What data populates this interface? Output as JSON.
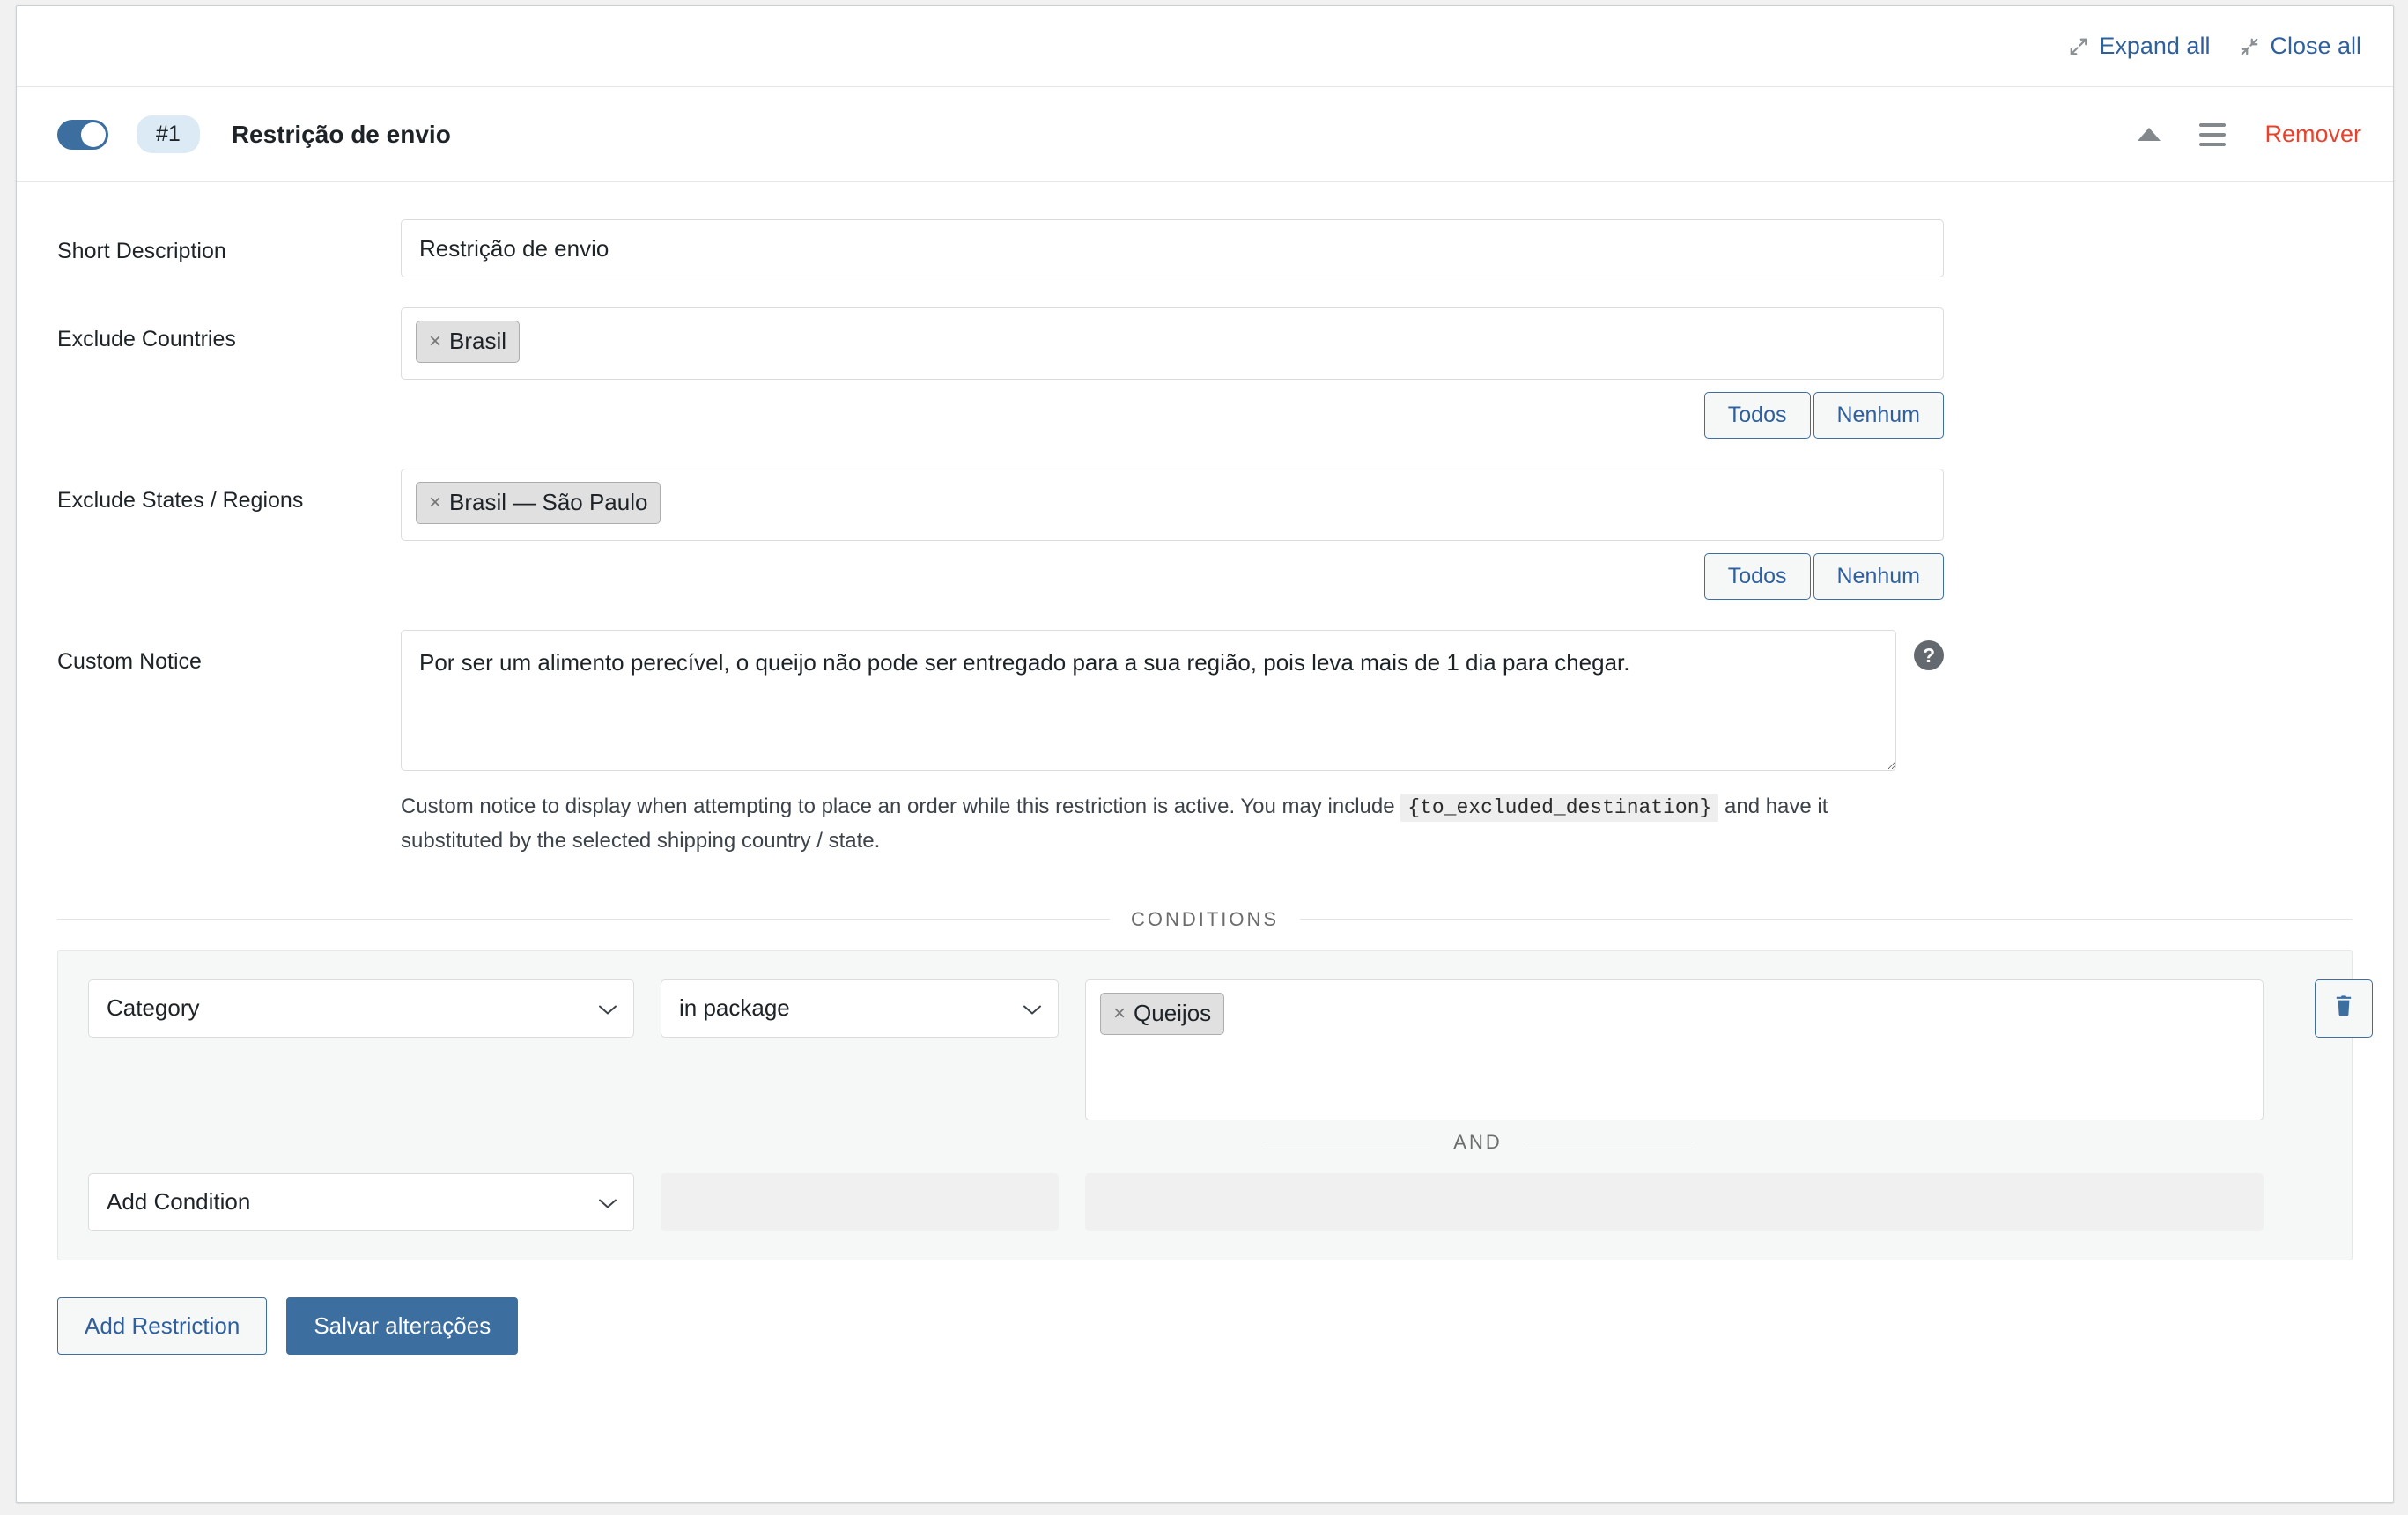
{
  "topbar": {
    "expand_all": "Expand all",
    "close_all": "Close all"
  },
  "restriction": {
    "index_badge": "#1",
    "title": "Restrição de envio",
    "enabled": true,
    "remove_label": "Remover"
  },
  "fields": {
    "short_description": {
      "label": "Short Description",
      "value": "Restrição de envio"
    },
    "exclude_countries": {
      "label": "Exclude Countries",
      "tags": [
        "Brasil"
      ],
      "all_label": "Todos",
      "none_label": "Nenhum"
    },
    "exclude_states": {
      "label": "Exclude States / Regions",
      "tags": [
        "Brasil — São Paulo"
      ],
      "all_label": "Todos",
      "none_label": "Nenhum"
    },
    "custom_notice": {
      "label": "Custom Notice",
      "value": "Por ser um alimento perecível, o queijo não pode ser entregado para a sua região, pois leva mais de 1 dia para chegar.",
      "help_before": "Custom notice to display when attempting to place an order while this restriction is active. You may include ",
      "help_token": "{to_excluded_destination}",
      "help_after": " and have it substituted by the selected shipping country / state.",
      "help_icon": "question-mark"
    }
  },
  "conditions": {
    "section_label": "CONDITIONS",
    "and_label": "AND",
    "rows": [
      {
        "type": "Category",
        "operator": "in package",
        "tags": [
          "Queijos"
        ]
      }
    ],
    "add_condition_label": "Add Condition"
  },
  "footer": {
    "add_restriction": "Add Restriction",
    "save": "Salvar alterações"
  },
  "colors": {
    "accent": "#3c6e9f",
    "link": "#2e5f9e",
    "danger": "#e8412c",
    "badge_bg": "#dbeaf4",
    "panel_bg": "#f6f7f7"
  }
}
